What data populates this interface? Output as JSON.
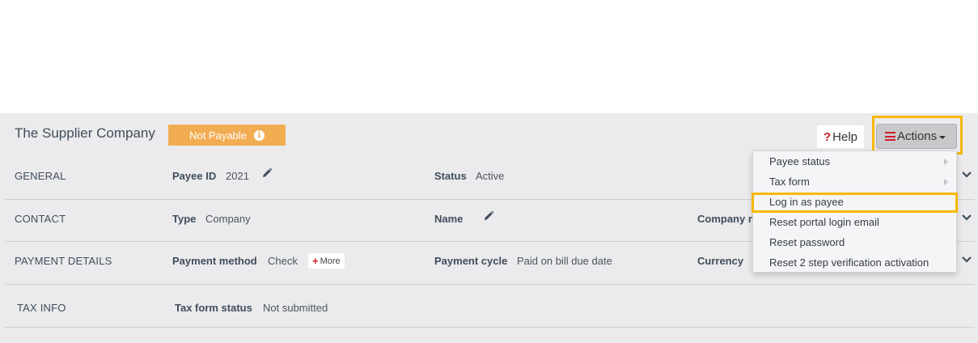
{
  "header": {
    "title": "The Supplier Company",
    "status_badge": "Not Payable",
    "help_label": "Help",
    "actions_label": "Actions"
  },
  "rows": {
    "general": {
      "label": "GENERAL",
      "payee_id_label": "Payee ID",
      "payee_id_value": "2021",
      "status_label": "Status",
      "status_value": "Active"
    },
    "contact": {
      "label": "CONTACT",
      "type_label": "Type",
      "type_value": "Company",
      "name_label": "Name",
      "company_label": "Company n"
    },
    "payment": {
      "label": "PAYMENT DETAILS",
      "method_label": "Payment method",
      "method_value": "Check",
      "more_label": "More",
      "cycle_label": "Payment cycle",
      "cycle_value": "Paid on bill due date",
      "currency_label": "Currency"
    },
    "tax": {
      "label": "TAX INFO",
      "status_label": "Tax form status",
      "status_value": "Not submitted"
    }
  },
  "actions_menu": {
    "items": [
      "Payee status",
      "Tax form",
      "Log in as payee",
      "Reset portal login email",
      "Reset password",
      "Reset 2 step verification activation"
    ]
  },
  "colors": {
    "badge": "#f2ad52",
    "highlight": "#f5b800",
    "accent_red": "#d0202a",
    "panel_bg": "#ebeaec"
  }
}
